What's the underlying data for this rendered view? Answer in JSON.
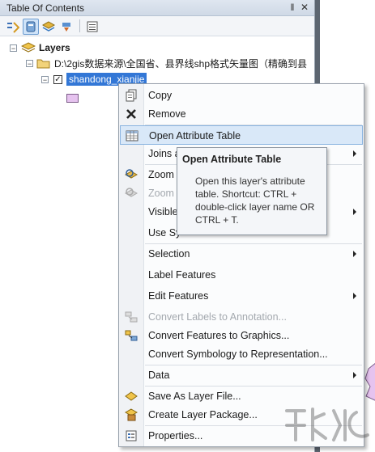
{
  "toc": {
    "title": "Table Of Contents",
    "pin_glyph": "‖",
    "close_glyph": "✕"
  },
  "tree": {
    "root_label": "Layers",
    "folder_label": "D:\\2gis数据来源\\全国省、县界线shp格式矢量图（精确到县",
    "layer_label": "shandong_xianjie"
  },
  "menu": {
    "items": [
      {
        "label": "Copy",
        "icon": "copy-icon",
        "disabled": false,
        "submenu": false
      },
      {
        "label": "Remove",
        "icon": "remove-icon",
        "disabled": false,
        "submenu": false
      },
      {
        "label": "Open Attribute Table",
        "icon": "table-icon",
        "disabled": false,
        "submenu": false,
        "highlighted": true
      },
      {
        "label": "Joins a",
        "icon": "",
        "disabled": false,
        "submenu": true
      },
      {
        "label": "Zoom",
        "icon": "zoom-to-layer-icon",
        "disabled": false,
        "submenu": false
      },
      {
        "label": "Zoom",
        "icon": "zoom-to-visible-icon",
        "disabled": true,
        "submenu": false
      },
      {
        "label": "Visible",
        "icon": "",
        "disabled": false,
        "submenu": true
      },
      {
        "label": "Use Sy",
        "icon": "",
        "disabled": false,
        "submenu": false
      },
      {
        "label": "Selection",
        "icon": "",
        "disabled": false,
        "submenu": true
      },
      {
        "label": "Label Features",
        "icon": "",
        "disabled": false,
        "submenu": false
      },
      {
        "label": "Edit Features",
        "icon": "",
        "disabled": false,
        "submenu": true
      },
      {
        "label": "Convert Labels to Annotation...",
        "icon": "convert-labels-icon",
        "disabled": true,
        "submenu": false
      },
      {
        "label": "Convert Features to Graphics...",
        "icon": "convert-features-icon",
        "disabled": false,
        "submenu": false
      },
      {
        "label": "Convert Symbology to Representation...",
        "icon": "",
        "disabled": false,
        "submenu": false
      },
      {
        "label": "Data",
        "icon": "",
        "disabled": false,
        "submenu": true
      },
      {
        "label": "Save As Layer File...",
        "icon": "save-layer-icon",
        "disabled": false,
        "submenu": false
      },
      {
        "label": "Create Layer Package...",
        "icon": "layer-package-icon",
        "disabled": false,
        "submenu": false
      },
      {
        "label": "Properties...",
        "icon": "properties-icon",
        "disabled": false,
        "submenu": false
      }
    ]
  },
  "tooltip": {
    "title": "Open Attribute Table",
    "body": "Open this layer's attribute table. Shortcut: CTRL + double-click layer name OR CTRL + T."
  },
  "colors": {
    "selection": "#3377d6",
    "menu_highlight": "#d9e8f8",
    "swatch_fill": "#e6c3ef"
  }
}
